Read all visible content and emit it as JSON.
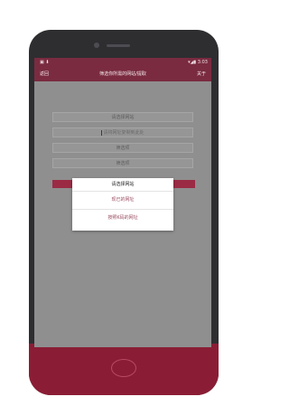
{
  "status": {
    "left": "▣ ⬇",
    "right": "▾◢▮ 3:03"
  },
  "toolbar": {
    "back": "返回",
    "title": "筛选你所需的网站/提取",
    "right": "关于"
  },
  "form": {
    "select_site": "请选择网站",
    "input_hint": "请将网址复制到此处",
    "field3": "筛选项",
    "field4": "筛选项"
  },
  "dialog": {
    "title": "请选择网站",
    "options": [
      "现已的网址",
      "按照K码的网址"
    ]
  },
  "colors": {
    "accent": "#7a2b40",
    "phone_body": "#8a1d35"
  }
}
